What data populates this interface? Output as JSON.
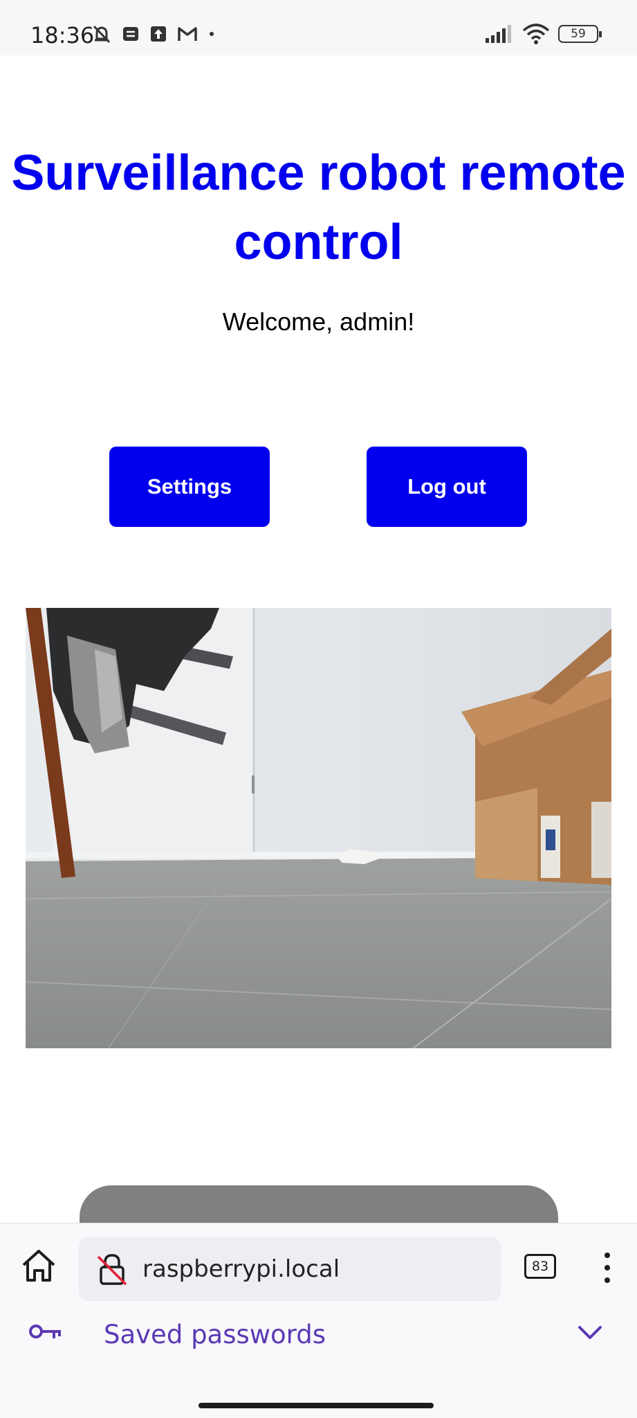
{
  "status_bar": {
    "time": "18:36",
    "battery": "59",
    "icons": [
      "bell-off-icon",
      "notes-icon",
      "upload-icon",
      "gmail-icon",
      "dot-icon",
      "signal-icon",
      "wifi-icon",
      "battery-icon"
    ]
  },
  "page": {
    "title_line1": "Surveillance robot remote",
    "title_line2": "control",
    "welcome": "Welcome, admin!",
    "buttons": {
      "settings": "Settings",
      "logout": "Log out"
    },
    "accent_color": "#0000ee"
  },
  "browser": {
    "url": "raspberrypi.local",
    "tab_count": "83",
    "icons": [
      "home-icon",
      "insecure-lock-icon",
      "tabs-icon",
      "more-icon"
    ]
  },
  "password_bar": {
    "label": "Saved passwords",
    "color": "#5b39b3",
    "icons": [
      "key-icon",
      "chevron-down-icon"
    ]
  }
}
